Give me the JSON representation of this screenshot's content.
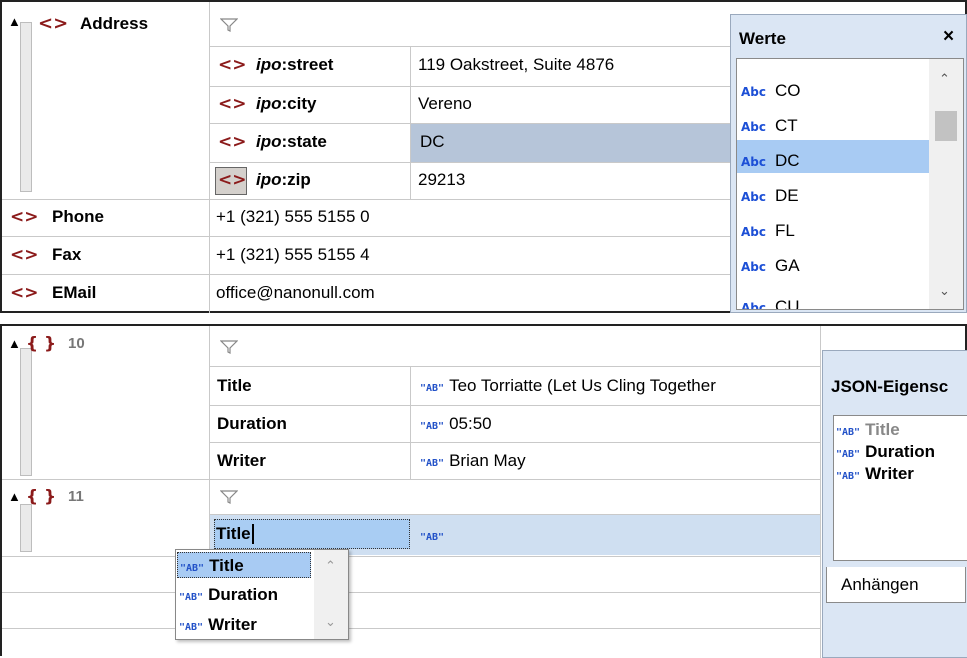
{
  "xml_grid": {
    "address": {
      "tag": "<>",
      "label": "Address"
    },
    "children": [
      {
        "prefix": "ipo",
        "local": ":street",
        "value": "119 Oakstreet, Suite 4876"
      },
      {
        "prefix": "ipo",
        "local": ":city",
        "value": "Vereno"
      },
      {
        "prefix": "ipo",
        "local": ":state",
        "value": "DC"
      },
      {
        "prefix": "ipo",
        "local": ":zip",
        "value": "29213"
      }
    ],
    "rows": [
      {
        "label": "Phone",
        "value": "+1 (321) 555 5155 0"
      },
      {
        "label": "Fax",
        "value": "+1 (321) 555 5155 4"
      },
      {
        "label": "EMail",
        "value": "office@nanonull.com"
      }
    ]
  },
  "werte": {
    "title": "Werte",
    "close": "×",
    "abc": "Abc",
    "items": [
      "CO",
      "CT",
      "DC",
      "DE",
      "FL",
      "GA",
      "CU"
    ],
    "selected": "DC"
  },
  "json_grid": {
    "obj10": {
      "brace": "{ }",
      "index": "10"
    },
    "obj11": {
      "brace": "{ }",
      "index": "11"
    },
    "fields": [
      {
        "key": "Title",
        "value": "Teo Torriatte (Let Us Cling Together"
      },
      {
        "key": "Duration",
        "value": "05:50"
      },
      {
        "key": "Writer",
        "value": "Brian May"
      }
    ],
    "edit": {
      "key": "Title",
      "value": ""
    },
    "ab_icon": "\"AB\""
  },
  "autocomplete": {
    "items": [
      "Title",
      "Duration",
      "Writer"
    ],
    "selected": "Title"
  },
  "json_props": {
    "title": "JSON-Eigensc",
    "items": [
      "Title",
      "Duration",
      "Writer"
    ],
    "tab": "Anhängen"
  }
}
